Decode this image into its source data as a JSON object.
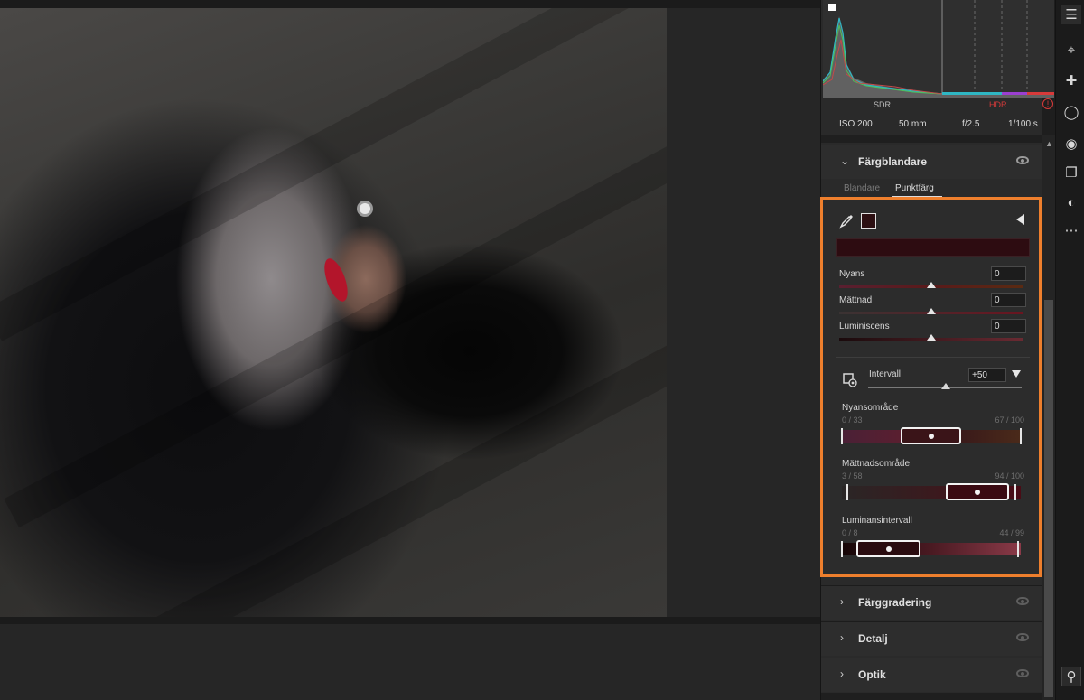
{
  "histogram": {
    "sdr_label": "SDR",
    "hdr_label": "HDR",
    "warning_icon": "warning-circle-icon"
  },
  "exif": {
    "iso": "ISO 200",
    "focal_length": "50 mm",
    "aperture": "f/2.5",
    "shutter": "1/100 s"
  },
  "color_mixer": {
    "title": "Färgblandare",
    "tabs": [
      {
        "label": "Blandare",
        "active": false
      },
      {
        "label": "Punktfärg",
        "active": true
      }
    ],
    "sampled_color": "#2d0c11",
    "params": [
      {
        "label": "Nyans",
        "value": "0",
        "level": 0.5
      },
      {
        "label": "Mättnad",
        "value": "0",
        "level": 0.5
      },
      {
        "label": "Luminiscens",
        "value": "0",
        "level": 0.5
      }
    ],
    "intervall": {
      "label": "Intervall",
      "value": "+50",
      "level": 0.5
    },
    "ranges": [
      {
        "label": "Nyansområde",
        "low": "0 / 33",
        "high": "67 / 100"
      },
      {
        "label": "Mättnadsområde",
        "low": "3 / 58",
        "high": "94 / 100"
      },
      {
        "label": "Luminansintervall",
        "low": "0 / 8",
        "high": "44 / 99"
      }
    ]
  },
  "sections": [
    {
      "title": "Färggradering"
    },
    {
      "title": "Detalj"
    },
    {
      "title": "Optik"
    }
  ],
  "toolbar": {
    "icons": [
      "sliders-icon",
      "crop-icon",
      "healing-bandage-icon",
      "mask-circle-icon",
      "red-eye-icon",
      "presets-stack-icon",
      "color-circle-icon",
      "more-dots-icon",
      "zoom-search-icon"
    ]
  },
  "colors": {
    "highlight": "#ee7f2d",
    "hdr": "#d83a3a"
  }
}
